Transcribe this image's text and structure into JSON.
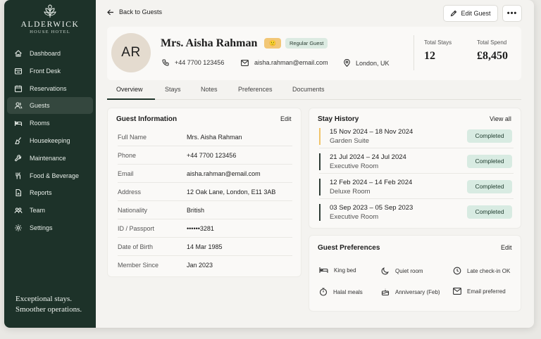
{
  "brand": {
    "name": "ALDERWICK",
    "sub": "HOUSE HOTEL",
    "tagline_1": "Exceptional stays.",
    "tagline_2": "Smoother operations."
  },
  "nav": [
    {
      "label": "Dashboard",
      "icon": "home-icon",
      "active": false
    },
    {
      "label": "Front Desk",
      "icon": "front-desk-icon",
      "active": false
    },
    {
      "label": "Reservations",
      "icon": "calendar-icon",
      "active": false
    },
    {
      "label": "Guests",
      "icon": "users-icon",
      "active": true
    },
    {
      "label": "Rooms",
      "icon": "bed-icon",
      "active": false
    },
    {
      "label": "Housekeeping",
      "icon": "broom-icon",
      "active": false
    },
    {
      "label": "Maintenance",
      "icon": "wrench-icon",
      "active": false
    },
    {
      "label": "Food & Beverage",
      "icon": "utensils-icon",
      "active": false
    },
    {
      "label": "Reports",
      "icon": "report-icon",
      "active": false
    },
    {
      "label": "Team",
      "icon": "team-icon",
      "active": false
    },
    {
      "label": "Settings",
      "icon": "gear-icon",
      "active": false
    }
  ],
  "topbar": {
    "back_label": "Back to Guests",
    "edit_label": "Edit Guest",
    "more_label": "•••"
  },
  "guest": {
    "initials": "AR",
    "name": "Mrs. Aisha Rahman",
    "emoji_badge": "🙂",
    "tag": "Regular Guest",
    "phone": "+44 7700 123456",
    "email": "aisha.rahman@email.com",
    "location": "London, UK"
  },
  "stats": {
    "stays_label": "Total Stays",
    "stays_value": "12",
    "spend_label": "Total Spend",
    "spend_value": "£8,450"
  },
  "tabs": [
    "Overview",
    "Stays",
    "Notes",
    "Preferences",
    "Documents"
  ],
  "info": {
    "title": "Guest Information",
    "edit": "Edit",
    "rows": [
      {
        "label": "Full Name",
        "value": "Mrs. Aisha Rahman"
      },
      {
        "label": "Phone",
        "value": "+44 7700 123456"
      },
      {
        "label": "Email",
        "value": "aisha.rahman@email.com"
      },
      {
        "label": "Address",
        "value": "12 Oak Lane, London, E11 3AB"
      },
      {
        "label": "Nationality",
        "value": "British"
      },
      {
        "label": "ID / Passport",
        "value": "••••••3281"
      },
      {
        "label": "Date of Birth",
        "value": "14 Mar 1985"
      },
      {
        "label": "Member Since",
        "value": "Jan 2023"
      }
    ]
  },
  "history": {
    "title": "Stay History",
    "link": "View all",
    "stays": [
      {
        "dates": "15 Nov 2024 – 18 Nov 2024",
        "room": "Garden Suite",
        "status": "Completed"
      },
      {
        "dates": "21 Jul 2024 – 24 Jul 2024",
        "room": "Executive Room",
        "status": "Completed"
      },
      {
        "dates": "12 Feb 2024 – 14 Feb 2024",
        "room": "Deluxe Room",
        "status": "Completed"
      },
      {
        "dates": "03 Sep 2023 – 05 Sep 2023",
        "room": "Executive Room",
        "status": "Completed"
      }
    ]
  },
  "preferences": {
    "title": "Guest Preferences",
    "edit": "Edit",
    "items": [
      {
        "label": "King bed",
        "icon": "bed-icon"
      },
      {
        "label": "Quiet room",
        "icon": "moon-icon"
      },
      {
        "label": "Late check-in OK",
        "icon": "clock-icon"
      },
      {
        "label": "Halal meals",
        "icon": "meal-icon"
      },
      {
        "label": "Anniversary (Feb)",
        "icon": "cake-icon"
      },
      {
        "label": "Email preferred",
        "icon": "mail-icon"
      }
    ]
  }
}
